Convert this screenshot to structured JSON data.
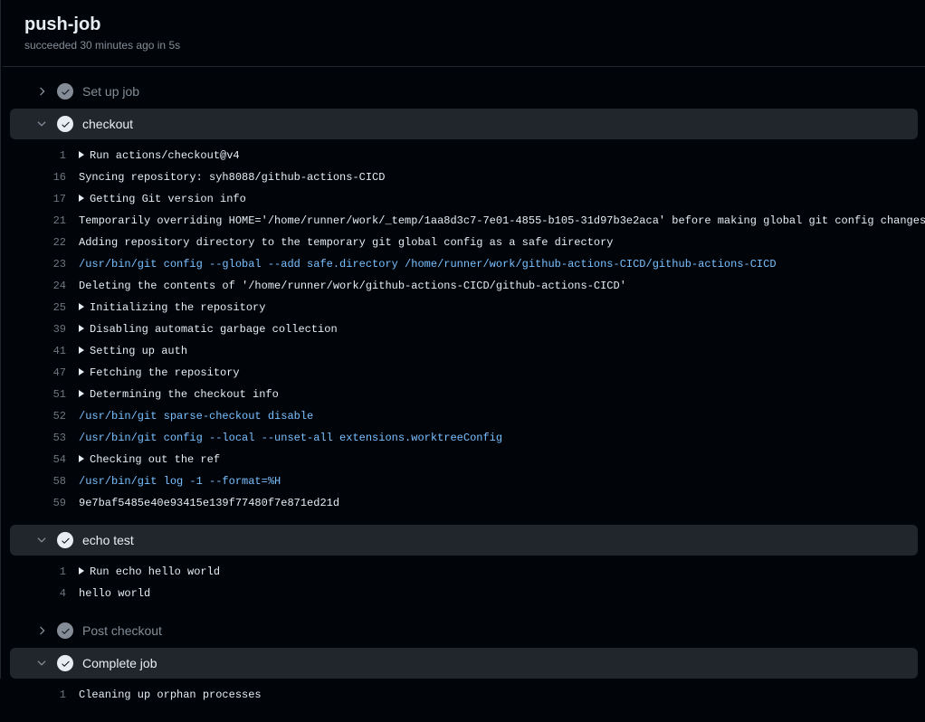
{
  "header": {
    "title": "push-job",
    "status_line": "succeeded 30 minutes ago in 5s"
  },
  "steps": [
    {
      "name": "Set up job",
      "expanded": false,
      "lines": []
    },
    {
      "name": "checkout",
      "expanded": true,
      "lines": [
        {
          "n": 1,
          "fold": true,
          "style": "plain",
          "text": "Run actions/checkout@v4"
        },
        {
          "n": 16,
          "fold": false,
          "style": "plain",
          "text": "Syncing repository: syh8088/github-actions-CICD"
        },
        {
          "n": 17,
          "fold": true,
          "style": "plain",
          "text": "Getting Git version info"
        },
        {
          "n": 21,
          "fold": false,
          "style": "plain",
          "text": "Temporarily overriding HOME='/home/runner/work/_temp/1aa8d3c7-7e01-4855-b105-31d97b3e2aca' before making global git config changes"
        },
        {
          "n": 22,
          "fold": false,
          "style": "plain",
          "text": "Adding repository directory to the temporary git global config as a safe directory"
        },
        {
          "n": 23,
          "fold": false,
          "style": "cmd",
          "text": "/usr/bin/git config --global --add safe.directory /home/runner/work/github-actions-CICD/github-actions-CICD"
        },
        {
          "n": 24,
          "fold": false,
          "style": "plain",
          "text": "Deleting the contents of '/home/runner/work/github-actions-CICD/github-actions-CICD'"
        },
        {
          "n": 25,
          "fold": true,
          "style": "plain",
          "text": "Initializing the repository"
        },
        {
          "n": 39,
          "fold": true,
          "style": "plain",
          "text": "Disabling automatic garbage collection"
        },
        {
          "n": 41,
          "fold": true,
          "style": "plain",
          "text": "Setting up auth"
        },
        {
          "n": 47,
          "fold": true,
          "style": "plain",
          "text": "Fetching the repository"
        },
        {
          "n": 51,
          "fold": true,
          "style": "plain",
          "text": "Determining the checkout info"
        },
        {
          "n": 52,
          "fold": false,
          "style": "cmd",
          "text": "/usr/bin/git sparse-checkout disable"
        },
        {
          "n": 53,
          "fold": false,
          "style": "cmd",
          "text": "/usr/bin/git config --local --unset-all extensions.worktreeConfig"
        },
        {
          "n": 54,
          "fold": true,
          "style": "plain",
          "text": "Checking out the ref"
        },
        {
          "n": 58,
          "fold": false,
          "style": "cmd",
          "text": "/usr/bin/git log -1 --format=%H"
        },
        {
          "n": 59,
          "fold": false,
          "style": "plain",
          "text": "9e7baf5485e40e93415e139f77480f7e871ed21d"
        }
      ]
    },
    {
      "name": "echo test",
      "expanded": true,
      "lines": [
        {
          "n": 1,
          "fold": true,
          "style": "plain",
          "text": "Run echo hello world"
        },
        {
          "n": 4,
          "fold": false,
          "style": "plain",
          "text": "hello world"
        }
      ]
    },
    {
      "name": "Post checkout",
      "expanded": false,
      "lines": []
    },
    {
      "name": "Complete job",
      "expanded": true,
      "lines": [
        {
          "n": 1,
          "fold": false,
          "style": "plain",
          "text": "Cleaning up orphan processes"
        }
      ]
    }
  ]
}
